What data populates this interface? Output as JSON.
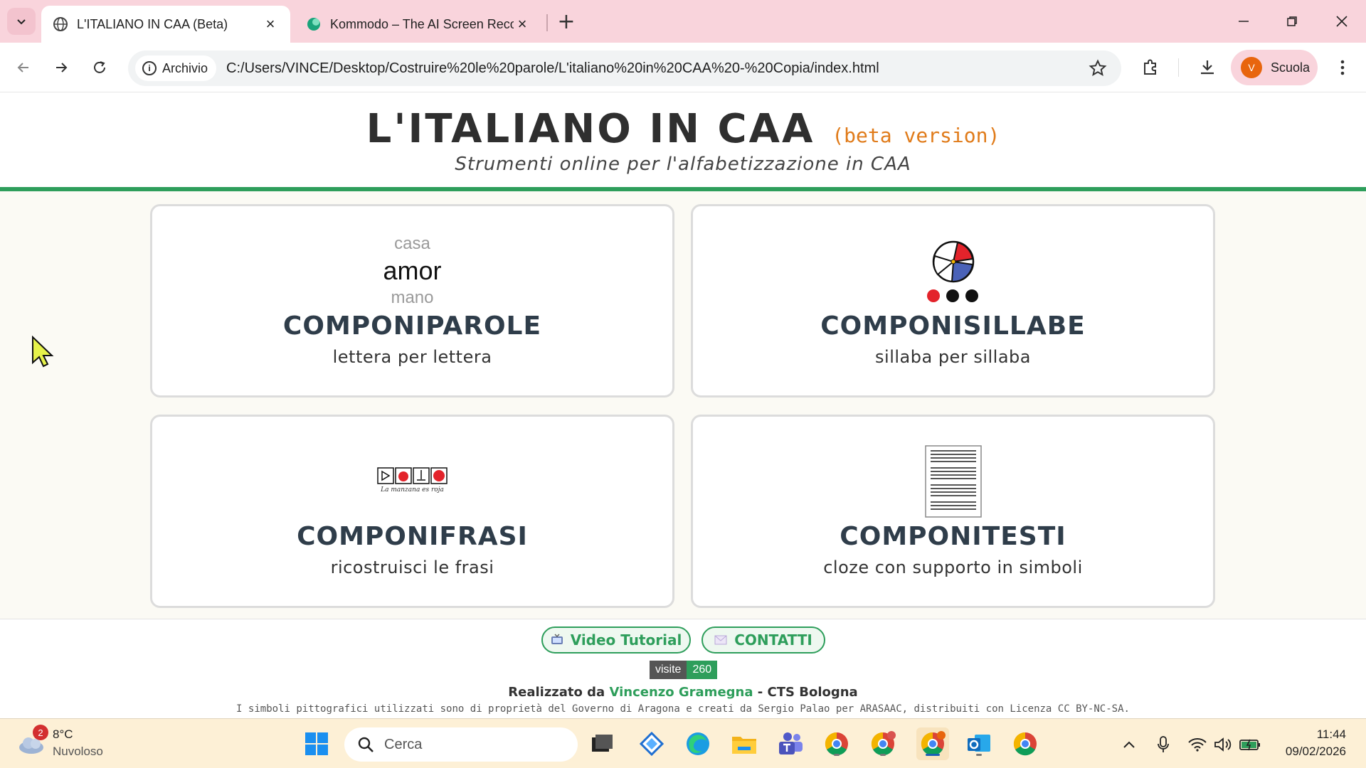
{
  "browser": {
    "tabs": [
      {
        "title": "L'ITALIANO IN CAA (Beta)",
        "active": true
      },
      {
        "title": "Kommodo – The AI Screen Recorder",
        "active": false
      }
    ],
    "address_chip": "Archivio",
    "url": "C:/Users/VINCE/Desktop/Costruire%20le%20parole/L'italiano%20in%20CAA%20-%20Copia/index.html",
    "profile_initial": "V",
    "profile_name": "Scuola"
  },
  "site": {
    "title": "L'ITALIANO IN CAA",
    "beta": "(beta version)",
    "subtitle": "Strumenti online per l'alfabetizzazione in CAA",
    "accent_color": "#2e9e5b"
  },
  "cards": [
    {
      "title": "COMPONIPAROLE",
      "subtitle": "lettera per lettera",
      "words": [
        "casa",
        "amor",
        "mano"
      ]
    },
    {
      "title": "COMPONISILLABE",
      "subtitle": "sillaba per sillaba"
    },
    {
      "title": "COMPONIFRASI",
      "subtitle": "ricostruisci le frasi",
      "caption": "La manzana es roja"
    },
    {
      "title": "COMPONITESTI",
      "subtitle": "cloze con supporto in simboli"
    }
  ],
  "footer": {
    "video_label": "Video Tutorial",
    "contact_label": "CONTATTI",
    "visits_label": "visite",
    "visits_count": "260",
    "credits_prefix": "Realizzato da",
    "author": "Vincenzo Gramegna",
    "credits_suffix": "- CTS Bologna",
    "license": "I simboli pittografici utilizzati sono di proprietà del Governo di Aragona e creati da Sergio Palao per ARASAAC, distribuiti con Licenza CC BY-NC-SA."
  },
  "taskbar": {
    "weather_badge": "2",
    "temperature": "8°C",
    "condition": "Nuvoloso",
    "search_placeholder": "Cerca",
    "time": "11:44",
    "date": "09/02/2026"
  }
}
